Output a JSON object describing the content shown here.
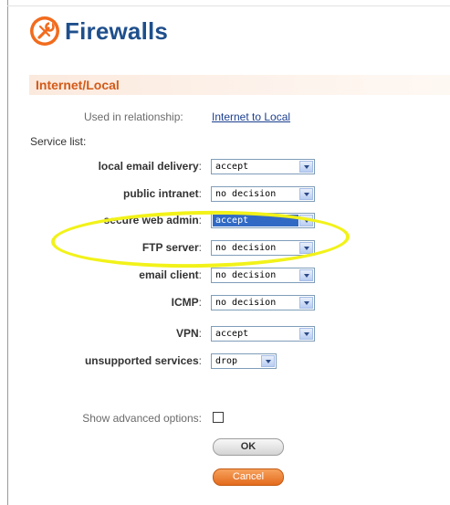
{
  "header": {
    "title": "Firewalls",
    "icon": "tools-icon",
    "accent": "#f26b1d",
    "title_color": "#1f4f8c"
  },
  "section": {
    "title": "Internet/Local"
  },
  "relationship": {
    "label": "Used in relationship:",
    "link": "Internet to Local"
  },
  "service_list": {
    "label": "Service list:",
    "rows": [
      {
        "name": "local email delivery",
        "value": "accept"
      },
      {
        "name": "public intranet",
        "value": "no decision"
      },
      {
        "name": "secure web admin",
        "value": "accept",
        "highlighted": true
      },
      {
        "name": "FTP server",
        "value": "no decision"
      },
      {
        "name": "email client",
        "value": "no decision"
      },
      {
        "name": "ICMP",
        "value": "no decision"
      },
      {
        "name": "VPN",
        "value": "accept"
      },
      {
        "name": "unsupported services",
        "value": "drop"
      }
    ],
    "colon": ":"
  },
  "advanced": {
    "label": "Show advanced options:",
    "checked": false
  },
  "buttons": {
    "ok": "OK",
    "cancel": "Cancel"
  },
  "annotation": {
    "color": "#f2f21a",
    "target": "secure web admin"
  }
}
